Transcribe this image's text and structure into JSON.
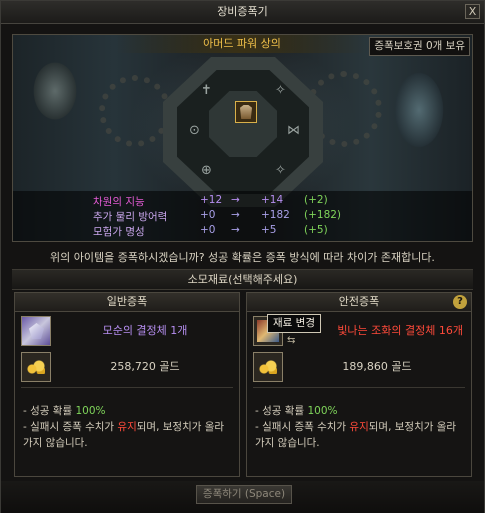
{
  "window": {
    "title": "장비증폭기",
    "close_label": "X"
  },
  "item": {
    "name": "아머드 파워 상의",
    "protect_text": "증폭보호권 0개 보유",
    "icon": "armor-chest-icon"
  },
  "stats": [
    {
      "name": "차원의 지능",
      "from": "+12",
      "to": "+14",
      "diff": "(+2)"
    },
    {
      "name": "추가 물리 방어력",
      "from": "+0",
      "to": "+182",
      "diff": "(+182)"
    },
    {
      "name": "모험가 명성",
      "from": "+0",
      "to": "+5",
      "diff": "(+5)"
    }
  ],
  "arrow": "→",
  "message": "위의 아이템을 증폭하시겠습니까? 성공 확률은 증폭 방식에 따라 차이가 존재합니다.",
  "section_title": "소모재료(선택해주세요)",
  "normal": {
    "header": "일반증폭",
    "material": "모순의 결정체 1개",
    "gold": "258,720 골드",
    "rate_prefix": "- 성공 확률 ",
    "rate_value": "100%",
    "fail_prefix": "- 실패시 증폭 수치가 ",
    "fail_keep": "유지",
    "fail_suffix": "되며, 보정치가 올라가지 않습니다."
  },
  "safe": {
    "header": "안전증폭",
    "help": "?",
    "material": "빛나는 조화의 결정체 16개",
    "gold": "189,860 골드",
    "rate_prefix": "- 성공 확률 ",
    "rate_value": "100%",
    "fail_prefix": "- 실패시 증폭 수치가 ",
    "fail_keep": "유지",
    "fail_suffix": "되며, 보정치가 올라가지 않습니다."
  },
  "tooltip": "재료 변경",
  "swap_glyph": "⇆",
  "enhance_button": "증폭하기 (Space)",
  "colors": {
    "gold_title": "#f0c04a",
    "green": "#7fd45a",
    "red": "#ff4a3a",
    "pink": "#e55bd6"
  }
}
